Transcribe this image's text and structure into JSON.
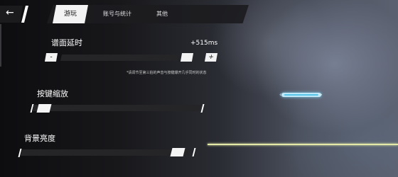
{
  "header": {
    "back_icon": "arrow-left-icon",
    "tabs": [
      {
        "label": "游玩",
        "active": true
      },
      {
        "label": "账号与统计",
        "active": false
      },
      {
        "label": "其他",
        "active": false
      }
    ]
  },
  "settings": {
    "offset": {
      "label": "谱面延时",
      "value": "+515ms",
      "minus_label": "-",
      "plus_label": "+",
      "note": "*请调节至第三拍的声音与按键爆开几乎同时的状态"
    },
    "key_scale": {
      "label": "按键缩放",
      "level": 0.03
    },
    "bg_brightness": {
      "label": "背景亮度",
      "level": 0.97
    }
  },
  "preview": {
    "note_color": "#57c4ea",
    "judge_line_color": "#e4e9a8"
  }
}
